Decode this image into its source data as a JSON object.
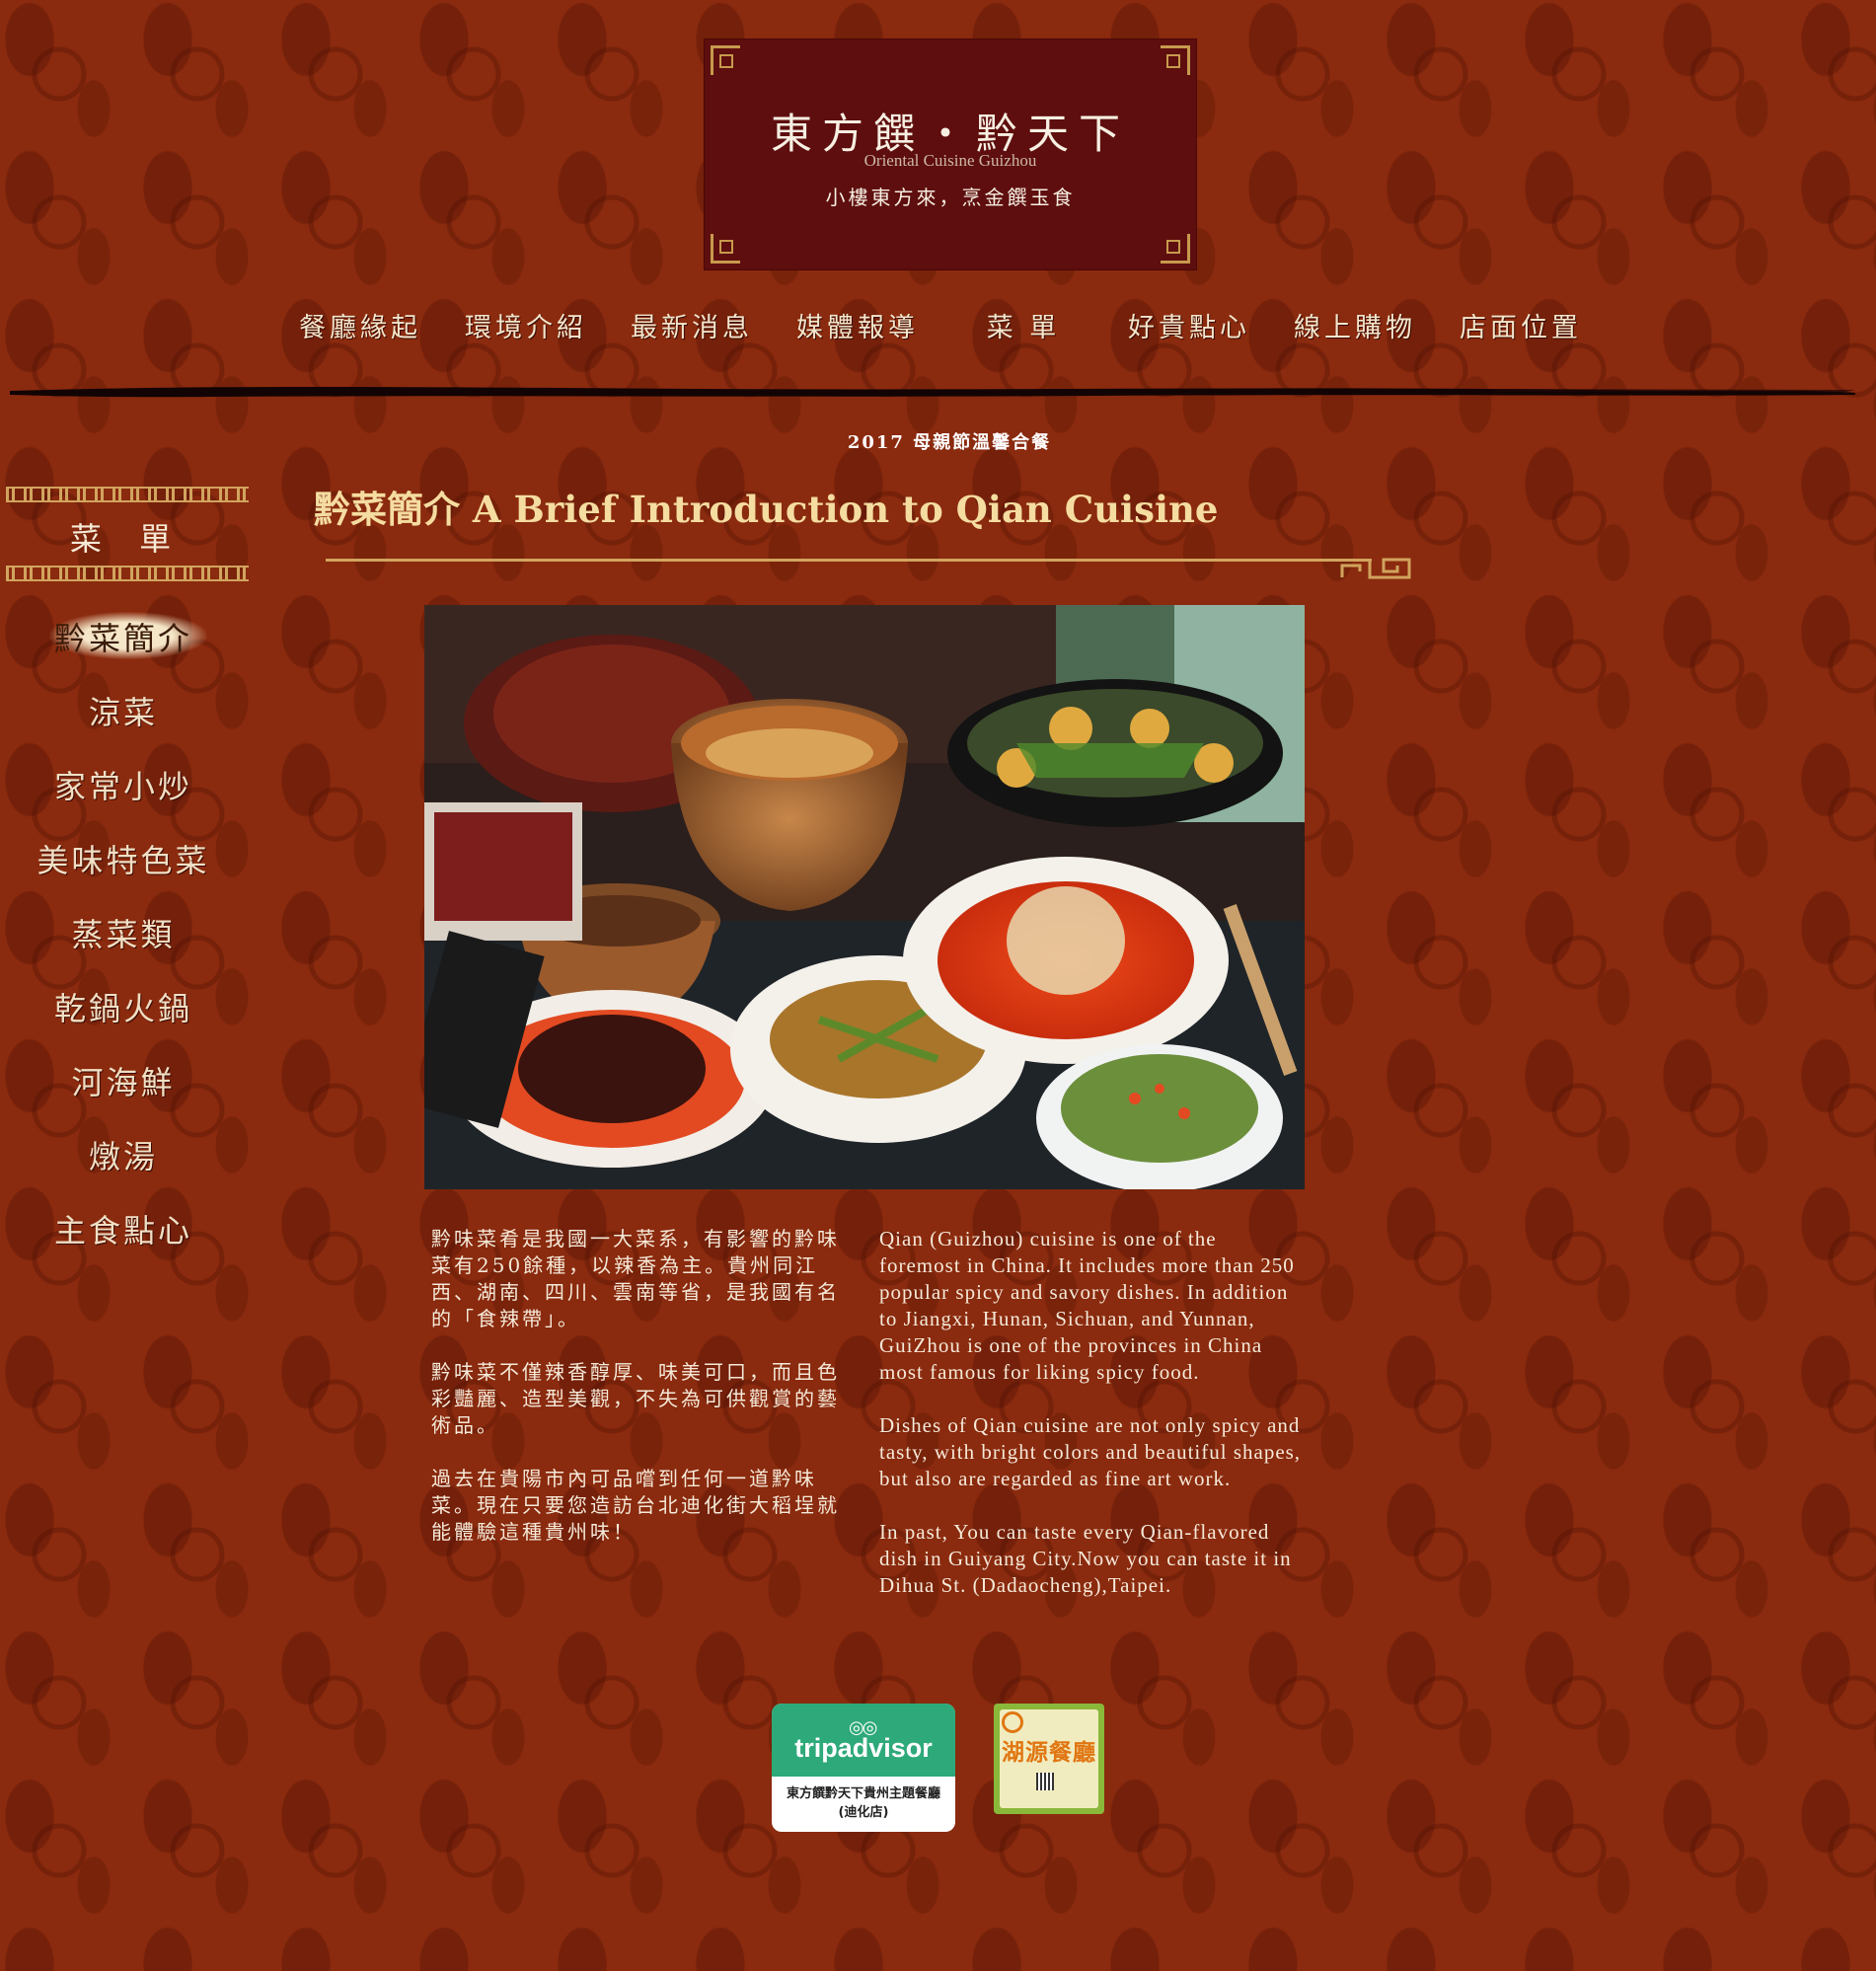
{
  "brand": {
    "title": "東方饌・黔天下",
    "subtitle": "Oriental Cuisine Guizhou",
    "slogan": "小樓東方來，烹金饌玉食"
  },
  "nav": [
    {
      "label": "餐廳緣起"
    },
    {
      "label": "環境介紹"
    },
    {
      "label": "最新消息"
    },
    {
      "label": "媒體報導"
    },
    {
      "label": "菜 單"
    },
    {
      "label": "好貴點心"
    },
    {
      "label": "線上購物"
    },
    {
      "label": "店面位置"
    }
  ],
  "promo": "2017 母親節溫馨合餐",
  "sidebar": {
    "title": "菜 單",
    "items": [
      {
        "label": "黔菜簡介"
      },
      {
        "label": "涼菜"
      },
      {
        "label": "家常小炒"
      },
      {
        "label": "美味特色菜"
      },
      {
        "label": "蒸菜類"
      },
      {
        "label": "乾鍋火鍋"
      },
      {
        "label": "河海鮮"
      },
      {
        "label": "燉湯"
      },
      {
        "label": "主食點心"
      }
    ]
  },
  "main": {
    "heading": "黔菜簡介 A Brief Introduction to Qian Cuisine",
    "zh_paragraphs": [
      "黔味菜肴是我國一大菜系，有影響的黔味菜有250餘種，以辣香為主。貴州同江西、湖南、四川、雲南等省，是我國有名的「食辣帶」。",
      "黔味菜不僅辣香醇厚、味美可口，而且色彩豔麗、造型美觀，不失為可供觀賞的藝術品。",
      "過去在貴陽市內可品嚐到任何一道黔味菜。現在只要您造訪台北迪化街大稻埕就能體驗這種貴州味！"
    ],
    "en_paragraphs": [
      "Qian (Guizhou) cuisine is one of the foremost in China. It includes more than 250 popular spicy and savory dishes. In addition to Jiangxi, Hunan, Sichuan, and Yunnan, GuiZhou is one of the provinces in China most famous for liking spicy food.",
      "Dishes of Qian cuisine are not only spicy and tasty, with bright colors and beautiful shapes, but also are regarded as fine art work.",
      "In past, You can taste every Qian-flavored dish in Guiyang City.Now you can taste it in Dihua St. (Dadaocheng),Taipei."
    ]
  },
  "badges": {
    "tripadvisor_word": "tripadvisor",
    "tripadvisor_caption": "東方饌黔天下貴州主題餐廳(迪化店)",
    "lake_title": "湖源餐廳"
  },
  "colors": {
    "background": "#8a2a0e",
    "logo_bg": "#5e0e0e",
    "heading": "#f5dca0",
    "gold": "#d1a45e",
    "tripadvisor_green": "#2ea97a"
  }
}
